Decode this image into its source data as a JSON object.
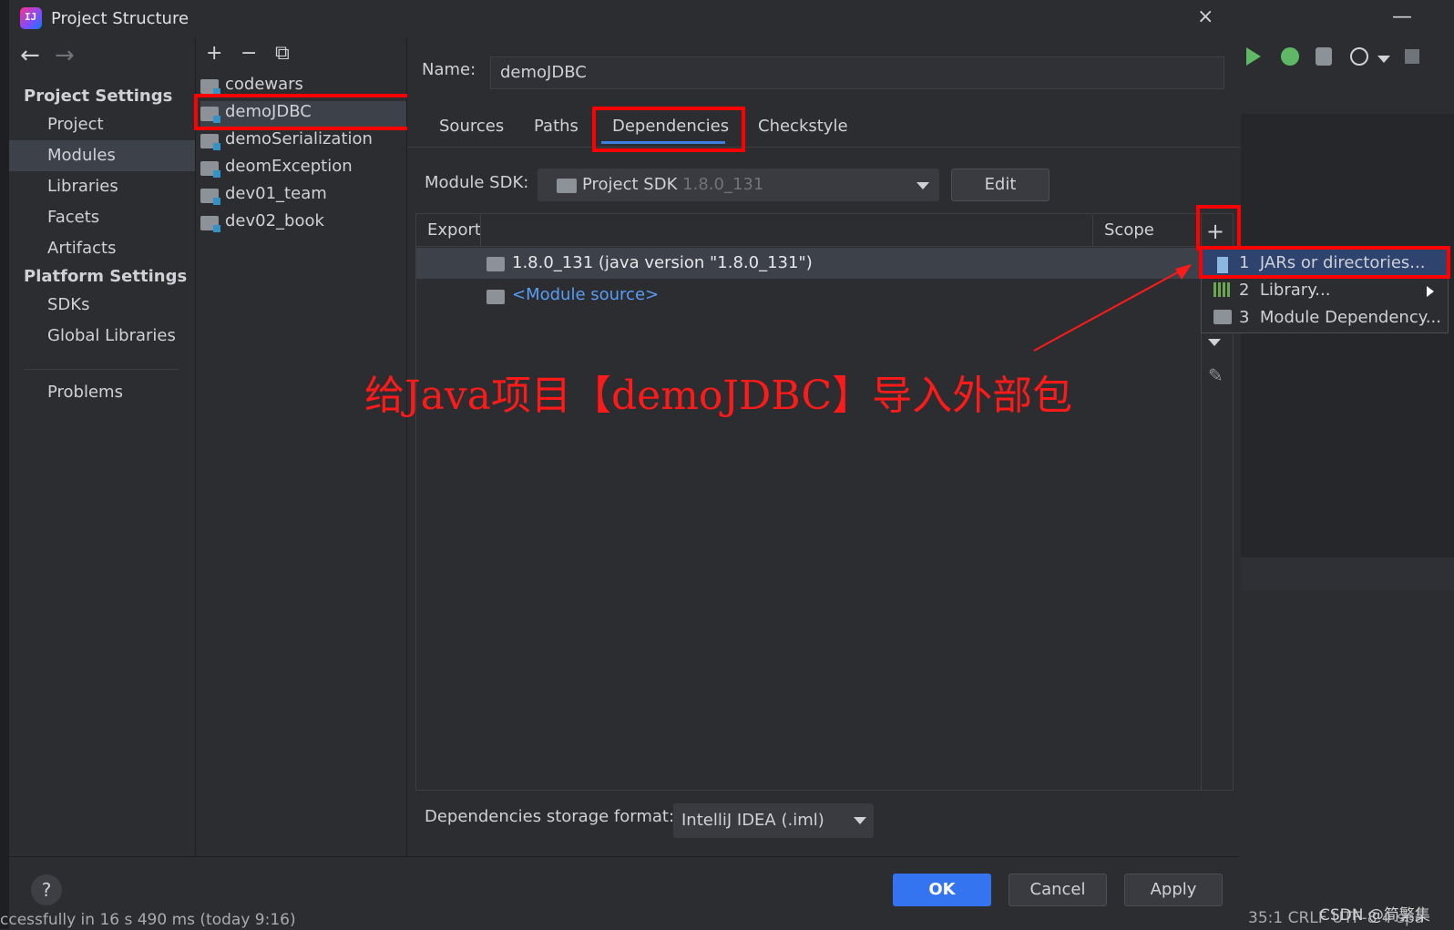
{
  "window": {
    "title": "Project Structure",
    "close": "×"
  },
  "nav": {
    "back": "←",
    "forward": "→",
    "project_settings": "Project Settings",
    "project_items": [
      "Project",
      "Modules",
      "Libraries",
      "Facets",
      "Artifacts"
    ],
    "platform_settings": "Platform Settings",
    "platform_items": [
      "SDKs",
      "Global Libraries"
    ],
    "problems": "Problems",
    "selected": "Modules"
  },
  "module_toolbar": {
    "add": "+",
    "remove": "−",
    "copy": "⧉"
  },
  "modules": [
    "codewars",
    "demoJDBC",
    "demoSerialization",
    "deomException",
    "dev01_team",
    "dev02_book"
  ],
  "selected_module": "demoJDBC",
  "main": {
    "name_label": "Name:",
    "name_value": "demoJDBC",
    "tabs": [
      "Sources",
      "Paths",
      "Dependencies",
      "Checkstyle"
    ],
    "active_tab": "Dependencies",
    "sdk_label": "Module SDK:",
    "sdk_value": "Project SDK",
    "sdk_version": "1.8.0_131",
    "edit_button": "Edit",
    "table_headers": {
      "export": "Export",
      "scope": "Scope"
    },
    "rows": [
      "1.8.0_131 (java version \"1.8.0_131\")",
      "<Module source>"
    ],
    "add_button": "+",
    "format_label": "Dependencies storage format:",
    "format_value": "IntelliJ IDEA (.iml)"
  },
  "popup": {
    "items": [
      {
        "num": "1",
        "label": "JARs or directories..."
      },
      {
        "num": "2",
        "label": "Library..."
      },
      {
        "num": "3",
        "label": "Module Dependency..."
      }
    ]
  },
  "annotation": "给Java项目【demoJDBC】导入外部包",
  "footer": {
    "help": "?",
    "ok": "OK",
    "cancel": "Cancel",
    "apply": "Apply"
  },
  "status": {
    "left_text": "ccessfully in 16 s 490 ms (today 9:16)",
    "right_text": "35:1   CRLF   UTF-8   4 spa",
    "watermark": "CSDN @简繁集"
  },
  "colors": {
    "accent": "#3574f0",
    "highlight": "#ff0000",
    "link": "#589df6"
  }
}
